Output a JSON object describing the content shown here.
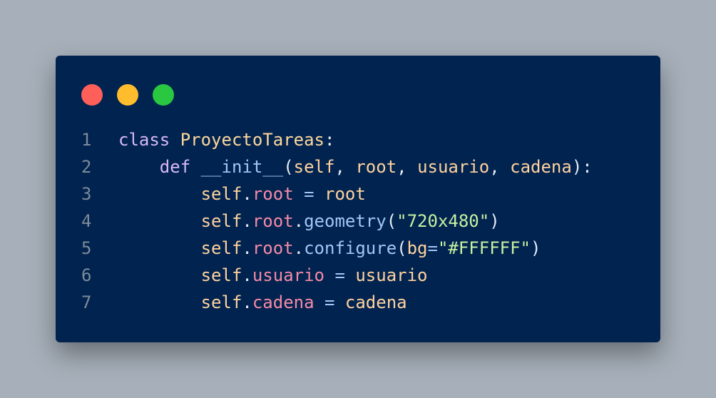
{
  "window": {
    "background": "#012350",
    "controls": [
      {
        "name": "close-dot",
        "color": "#ff5f59"
      },
      {
        "name": "minimize-dot",
        "color": "#ffbd2e"
      },
      {
        "name": "maximize-dot",
        "color": "#29c840"
      }
    ]
  },
  "colors": {
    "line_number": "#7d8a99",
    "keyword": "#d7b8f5",
    "class_name": "#fdd89c",
    "function": "#a2c6f7",
    "self": "#ffd29e",
    "param": "#ffd29e",
    "attribute": "#f58aa6",
    "method": "#a2c6f7",
    "string": "#c7f0a2",
    "punct": "#e4ecf5",
    "operator": "#a2c6f7",
    "plain": "#ffd29e"
  },
  "code": {
    "lines": [
      {
        "number": "1",
        "tokens": [
          {
            "t": "class",
            "k": "keyword"
          },
          {
            "t": " ",
            "k": "punct"
          },
          {
            "t": "ProyectoTareas",
            "k": "class_name"
          },
          {
            "t": ":",
            "k": "punct"
          }
        ]
      },
      {
        "number": "2",
        "tokens": [
          {
            "t": "    ",
            "k": "punct"
          },
          {
            "t": "def",
            "k": "keyword"
          },
          {
            "t": " ",
            "k": "punct"
          },
          {
            "t": "__init__",
            "k": "function"
          },
          {
            "t": "(",
            "k": "punct"
          },
          {
            "t": "self",
            "k": "self"
          },
          {
            "t": ", ",
            "k": "punct"
          },
          {
            "t": "root",
            "k": "param"
          },
          {
            "t": ", ",
            "k": "punct"
          },
          {
            "t": "usuario",
            "k": "param"
          },
          {
            "t": ", ",
            "k": "punct"
          },
          {
            "t": "cadena",
            "k": "param"
          },
          {
            "t": "):",
            "k": "punct"
          }
        ]
      },
      {
        "number": "3",
        "tokens": [
          {
            "t": "        ",
            "k": "punct"
          },
          {
            "t": "self",
            "k": "self"
          },
          {
            "t": ".",
            "k": "punct"
          },
          {
            "t": "root",
            "k": "attribute"
          },
          {
            "t": " = ",
            "k": "operator"
          },
          {
            "t": "root",
            "k": "plain"
          }
        ]
      },
      {
        "number": "4",
        "tokens": [
          {
            "t": "        ",
            "k": "punct"
          },
          {
            "t": "self",
            "k": "self"
          },
          {
            "t": ".",
            "k": "punct"
          },
          {
            "t": "root",
            "k": "attribute"
          },
          {
            "t": ".",
            "k": "punct"
          },
          {
            "t": "geometry",
            "k": "method"
          },
          {
            "t": "(",
            "k": "punct"
          },
          {
            "t": "\"720x480\"",
            "k": "string"
          },
          {
            "t": ")",
            "k": "punct"
          }
        ]
      },
      {
        "number": "5",
        "tokens": [
          {
            "t": "        ",
            "k": "punct"
          },
          {
            "t": "self",
            "k": "self"
          },
          {
            "t": ".",
            "k": "punct"
          },
          {
            "t": "root",
            "k": "attribute"
          },
          {
            "t": ".",
            "k": "punct"
          },
          {
            "t": "configure",
            "k": "method"
          },
          {
            "t": "(",
            "k": "punct"
          },
          {
            "t": "bg",
            "k": "param"
          },
          {
            "t": "=",
            "k": "operator"
          },
          {
            "t": "\"#FFFFFF\"",
            "k": "string"
          },
          {
            "t": ")",
            "k": "punct"
          }
        ]
      },
      {
        "number": "6",
        "tokens": [
          {
            "t": "        ",
            "k": "punct"
          },
          {
            "t": "self",
            "k": "self"
          },
          {
            "t": ".",
            "k": "punct"
          },
          {
            "t": "usuario",
            "k": "attribute"
          },
          {
            "t": " = ",
            "k": "operator"
          },
          {
            "t": "usuario",
            "k": "plain"
          }
        ]
      },
      {
        "number": "7",
        "tokens": [
          {
            "t": "        ",
            "k": "punct"
          },
          {
            "t": "self",
            "k": "self"
          },
          {
            "t": ".",
            "k": "punct"
          },
          {
            "t": "cadena",
            "k": "attribute"
          },
          {
            "t": " = ",
            "k": "operator"
          },
          {
            "t": "cadena",
            "k": "plain"
          }
        ]
      }
    ]
  }
}
